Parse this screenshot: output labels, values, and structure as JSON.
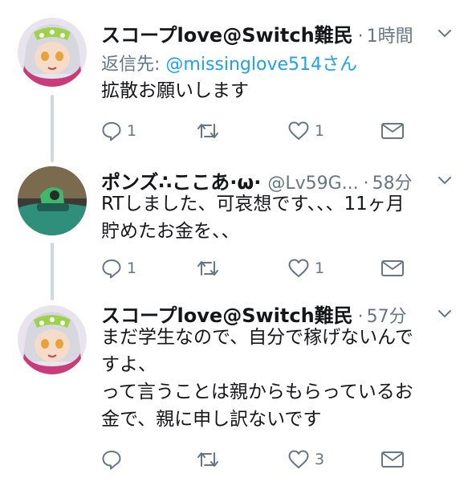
{
  "tweets": [
    {
      "name": "スコープlove@Switch難民",
      "handle": "",
      "dot": "·",
      "time": "1時間",
      "reply_to_label": "返信先: ",
      "reply_to_mention": "@missinglove514さん",
      "text": "拡散お願いします",
      "reply_count": "1",
      "retweet_count": "",
      "like_count": "1"
    },
    {
      "name": "ポンズ∴ここあ·ω·",
      "handle": "@Lv59G...",
      "dot": "·",
      "time": "58分",
      "text": "RTしました、可哀想です、、、11ヶ月\n貯めたお金を、、",
      "reply_count": "1",
      "retweet_count": "",
      "like_count": "1"
    },
    {
      "name": "スコープlove@Switch難民",
      "handle": "",
      "dot": "·",
      "time": "57分",
      "text": "まだ学生なので、自分で稼げないんで\nすよ、\nって言うことは親からもらっているお\n金で、親に申し訳ないです",
      "reply_count": "",
      "retweet_count": "",
      "like_count": "3"
    }
  ],
  "colors": {
    "icon_gray": "#657786",
    "link_blue": "#1da1f2",
    "thread_line": "#cfd9de"
  }
}
